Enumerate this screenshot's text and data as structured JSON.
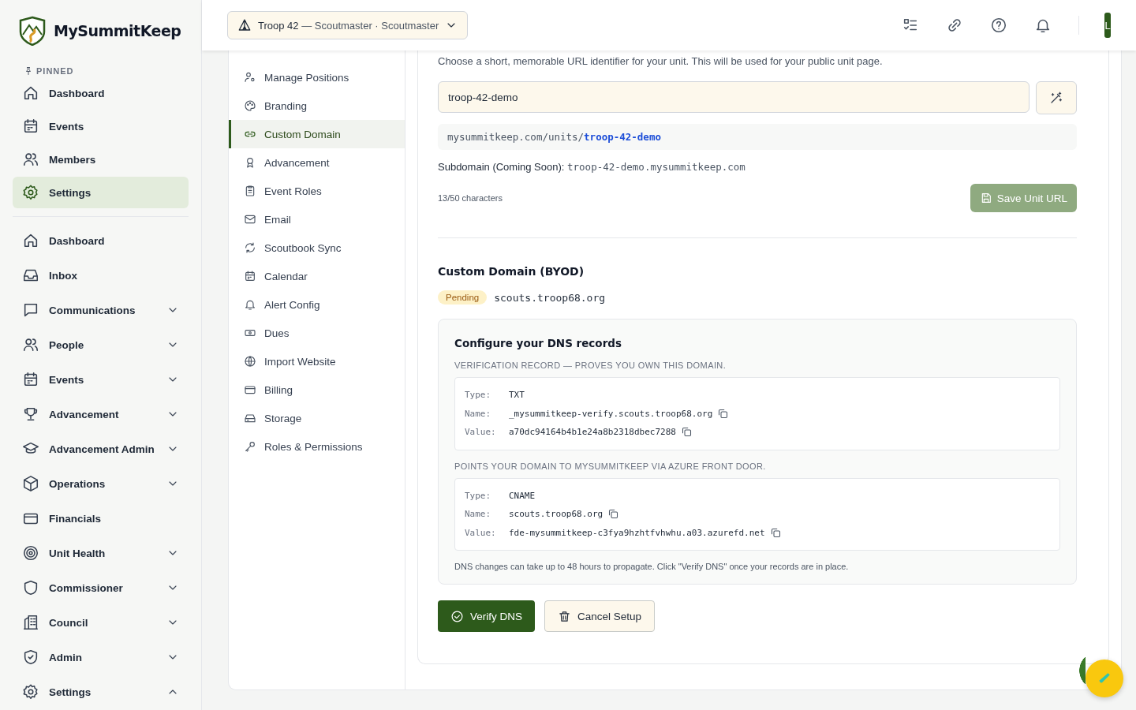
{
  "brand": {
    "name": "MySummitKeep"
  },
  "unit_selector": {
    "unit": "Troop 42",
    "role": "— Scoutmaster · Scoutmaster"
  },
  "account": {
    "initial": "L"
  },
  "sidebar": {
    "pinned_label": "PINNED",
    "pinned": [
      {
        "label": "Dashboard",
        "selected": false
      },
      {
        "label": "Events",
        "selected": false
      },
      {
        "label": "Members",
        "selected": false
      },
      {
        "label": "Settings",
        "selected": true
      }
    ],
    "items": [
      {
        "label": "Dashboard",
        "kind": "link"
      },
      {
        "label": "Inbox",
        "kind": "link"
      },
      {
        "label": "Communications",
        "kind": "group",
        "expanded": false
      },
      {
        "label": "People",
        "kind": "group",
        "expanded": false
      },
      {
        "label": "Events",
        "kind": "group",
        "expanded": false
      },
      {
        "label": "Advancement",
        "kind": "group",
        "expanded": false
      },
      {
        "label": "Advancement Admin",
        "kind": "group",
        "expanded": false
      },
      {
        "label": "Operations",
        "kind": "group",
        "expanded": false
      },
      {
        "label": "Financials",
        "kind": "link"
      },
      {
        "label": "Unit Health",
        "kind": "group",
        "expanded": false
      },
      {
        "label": "Commissioner",
        "kind": "group",
        "expanded": false
      },
      {
        "label": "Council",
        "kind": "group",
        "expanded": false
      },
      {
        "label": "Admin",
        "kind": "group",
        "expanded": false
      },
      {
        "label": "Settings",
        "kind": "group",
        "expanded": true
      }
    ]
  },
  "settings_nav": [
    {
      "label": "Manage Positions",
      "selected": false
    },
    {
      "label": "Branding",
      "selected": false
    },
    {
      "label": "Custom Domain",
      "selected": true
    },
    {
      "label": "Advancement",
      "selected": false
    },
    {
      "label": "Event Roles",
      "selected": false
    },
    {
      "label": "Email",
      "selected": false
    },
    {
      "label": "Scoutbook Sync",
      "selected": false
    },
    {
      "label": "Calendar",
      "selected": false
    },
    {
      "label": "Alert Config",
      "selected": false
    },
    {
      "label": "Dues",
      "selected": false
    },
    {
      "label": "Import Website",
      "selected": false
    },
    {
      "label": "Billing",
      "selected": false
    },
    {
      "label": "Storage",
      "selected": false
    },
    {
      "label": "Roles & Permissions",
      "selected": false
    }
  ],
  "unit_url": {
    "hint": "Choose a short, memorable URL identifier for your unit. This will be used for your public unit page.",
    "value": "troop-42-demo",
    "preview_prefix": "mysummitkeep.com/units/",
    "preview_slug": "troop-42-demo",
    "subdomain_label": "Subdomain (Coming Soon):",
    "subdomain_value": "troop-42-demo.mysummitkeep.com",
    "char_count": "13/50 characters",
    "save_button": {
      "label": "Save Unit URL",
      "disabled": true
    }
  },
  "custom_domain": {
    "title": "Custom Domain (BYOD)",
    "status": "Pending",
    "domain": "scouts.troop68.org",
    "dns": {
      "title": "Configure your DNS records",
      "records": [
        {
          "caption": "VERIFICATION RECORD — PROVES YOU OWN THIS DOMAIN.",
          "fields": [
            {
              "label": "Type:",
              "value": "TXT",
              "copyable": false
            },
            {
              "label": "Name:",
              "value": "_mysummitkeep-verify.scouts.troop68.org",
              "copyable": true
            },
            {
              "label": "Value:",
              "value": "a70dc94164b4b1e24a8b2318dbec7288",
              "copyable": true
            }
          ]
        },
        {
          "caption": "POINTS YOUR DOMAIN TO MYSUMMITKEEP VIA AZURE FRONT DOOR.",
          "fields": [
            {
              "label": "Type:",
              "value": "CNAME",
              "copyable": false
            },
            {
              "label": "Name:",
              "value": "scouts.troop68.org",
              "copyable": true
            },
            {
              "label": "Value:",
              "value": "fde-mysummitkeep-c3fya9hzhtfvhwhu.a03.azurefd.net",
              "copyable": true
            }
          ]
        }
      ],
      "note": "DNS changes can take up to 48 hours to propagate. Click \"Verify DNS\" once your records are in place."
    },
    "verify_button": "Verify DNS",
    "cancel_button": "Cancel Setup"
  }
}
